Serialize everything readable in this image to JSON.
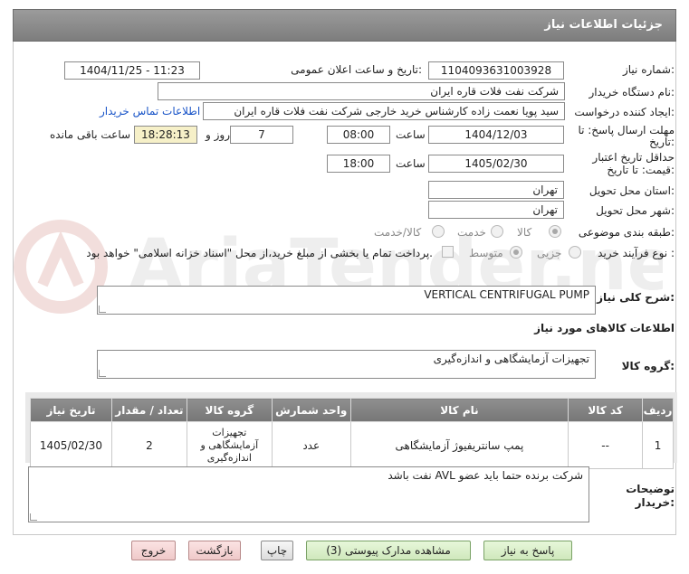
{
  "header": {
    "title": "جزئیات اطلاعات نیاز"
  },
  "form": {
    "need_number_label": "شماره نیاز:",
    "need_number": "1104093631003928",
    "announce_label": "تاریخ و ساعت اعلان عمومی:",
    "announce_value": "1404/11/25 - 11:23",
    "buyer_org_label": "نام دستگاه خریدار:",
    "buyer_org": "شرکت نفت فلات قاره ایران",
    "creator_label": "ایجاد کننده درخواست:",
    "creator": "سید پویا نعمت زاده کارشناس خرید خارجی شرکت نفت فلات قاره ایران",
    "contact_link": "اطلاعات تماس خریدار",
    "deadline_label_1": "مهلت ارسال پاسخ: تا",
    "deadline_label_2": "تاریخ:",
    "deadline_date": "1404/12/03",
    "time_label": "ساعت",
    "deadline_time": "08:00",
    "days_value": "7",
    "days_label": "روز و",
    "remaining_time": "18:28:13",
    "remaining_label": "ساعت باقی مانده",
    "validity_label_1": "حداقل تاریخ اعتبار",
    "validity_label_2": "قیمت: تا تاریخ:",
    "validity_date": "1405/02/30",
    "validity_time_label": "ساعت",
    "validity_time": "18:00",
    "province_label": "استان محل تحویل:",
    "province": "تهران",
    "city_label": "شهر محل تحویل:",
    "city": "تهران",
    "category_label": "طبقه بندی موضوعی:",
    "category_options": [
      "کالا",
      "خدمت",
      "کالا/خدمت"
    ],
    "process_label": "نوع فرآیند خرید :",
    "process_options": [
      "جزیی",
      "متوسط"
    ],
    "payment_note": "پرداخت تمام یا بخشی از مبلغ خرید،از محل \"اسناد خزانه اسلامی\" خواهد بود."
  },
  "description": {
    "label": "شرح کلی نیاز:",
    "value": "VERTICAL CENTRIFUGAL PUMP"
  },
  "goods_info_title": "اطلاعات کالاهای مورد نیاز",
  "goods_group": {
    "label": "گروه کالا:",
    "value": "تجهیزات آزمایشگاهی و اندازه‌گیری"
  },
  "table": {
    "headers": [
      "ردیف",
      "کد کالا",
      "نام کالا",
      "واحد شمارش",
      "گروه کالا",
      "تعداد / مقدار",
      "تاریخ نیاز"
    ],
    "rows": [
      {
        "row": "1",
        "code": "--",
        "name": "پمپ سانتریفیوژ آزمایشگاهی",
        "unit": "عدد",
        "group": "تجهیزات آزمایشگاهی و اندازه‌گیری",
        "qty": "2",
        "date": "1405/02/30"
      }
    ]
  },
  "buyer_notes": {
    "label_1": "توضیحات",
    "label_2": "خریدار:",
    "value": "شرکت برنده حتما باید عضو AVL نفت باشد"
  },
  "buttons": {
    "reply": "پاسخ به نیاز",
    "attachments": "مشاهده مدارک پیوستی (3)",
    "print": "چاپ",
    "back": "بازگشت",
    "exit": "خروج"
  },
  "watermark": {
    "text": "AriaTender.net"
  }
}
